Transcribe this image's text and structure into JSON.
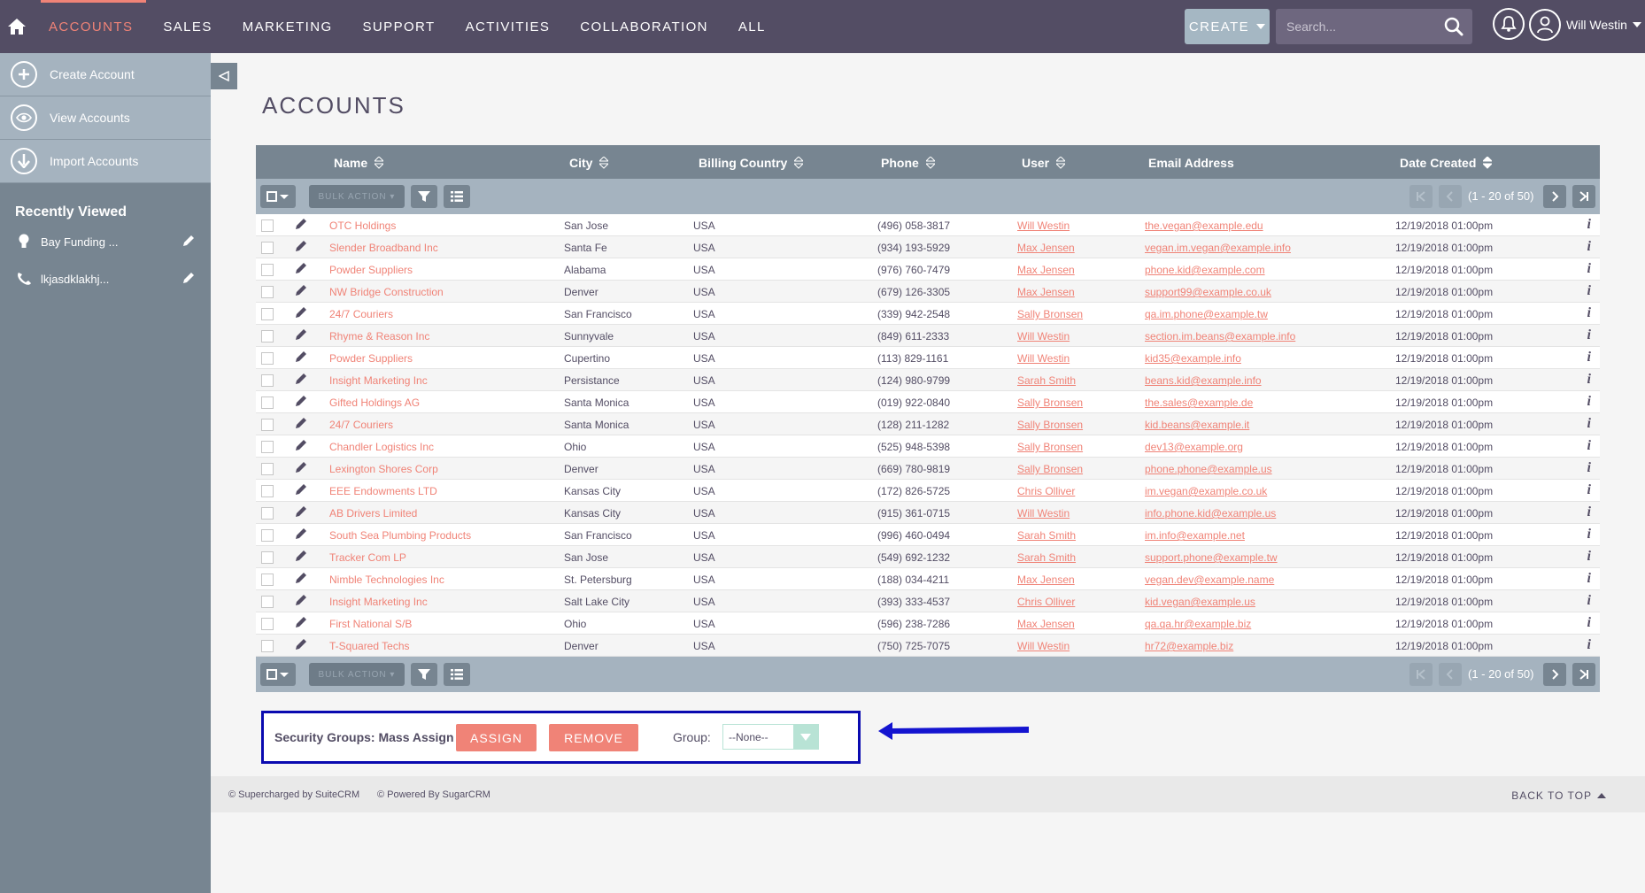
{
  "nav": {
    "items": [
      "ACCOUNTS",
      "SALES",
      "MARKETING",
      "SUPPORT",
      "ACTIVITIES",
      "COLLABORATION",
      "ALL"
    ],
    "create_label": "CREATE",
    "search_placeholder": "Search...",
    "user_name": "Will Westin"
  },
  "sidebar": {
    "actions": [
      "Create Account",
      "View Accounts",
      "Import Accounts"
    ],
    "recent_title": "Recently Viewed",
    "recent": [
      "Bay Funding ...",
      "lkjasdklakhj..."
    ]
  },
  "page_title": "ACCOUNTS",
  "table": {
    "columns": [
      "Name",
      "City",
      "Billing Country",
      "Phone",
      "User",
      "Email Address",
      "Date Created"
    ],
    "bulk_action_label": "BULK ACTION",
    "pagination": "(1 - 20 of 50)",
    "rows": [
      [
        "OTC Holdings",
        "San Jose",
        "USA",
        "(496) 058-3817",
        "Will Westin",
        "the.vegan@example.edu",
        "12/19/2018 01:00pm"
      ],
      [
        "Slender Broadband Inc",
        "Santa Fe",
        "USA",
        "(934) 193-5929",
        "Max Jensen",
        "vegan.im.vegan@example.info",
        "12/19/2018 01:00pm"
      ],
      [
        "Powder Suppliers",
        "Alabama",
        "USA",
        "(976) 760-7479",
        "Max Jensen",
        "phone.kid@example.com",
        "12/19/2018 01:00pm"
      ],
      [
        "NW Bridge Construction",
        "Denver",
        "USA",
        "(679) 126-3305",
        "Max Jensen",
        "support99@example.co.uk",
        "12/19/2018 01:00pm"
      ],
      [
        "24/7 Couriers",
        "San Francisco",
        "USA",
        "(339) 942-2548",
        "Sally Bronsen",
        "qa.im.phone@example.tw",
        "12/19/2018 01:00pm"
      ],
      [
        "Rhyme & Reason Inc",
        "Sunnyvale",
        "USA",
        "(849) 611-2333",
        "Will Westin",
        "section.im.beans@example.info",
        "12/19/2018 01:00pm"
      ],
      [
        "Powder Suppliers",
        "Cupertino",
        "USA",
        "(113) 829-1161",
        "Will Westin",
        "kid35@example.info",
        "12/19/2018 01:00pm"
      ],
      [
        "Insight Marketing Inc",
        "Persistance",
        "USA",
        "(124) 980-9799",
        "Sarah Smith",
        "beans.kid@example.info",
        "12/19/2018 01:00pm"
      ],
      [
        "Gifted Holdings AG",
        "Santa Monica",
        "USA",
        "(019) 922-0840",
        "Sally Bronsen",
        "the.sales@example.de",
        "12/19/2018 01:00pm"
      ],
      [
        "24/7 Couriers",
        "Santa Monica",
        "USA",
        "(128) 211-1282",
        "Sally Bronsen",
        "kid.beans@example.it",
        "12/19/2018 01:00pm"
      ],
      [
        "Chandler Logistics Inc",
        "Ohio",
        "USA",
        "(525) 948-5398",
        "Sally Bronsen",
        "dev13@example.org",
        "12/19/2018 01:00pm"
      ],
      [
        "Lexington Shores Corp",
        "Denver",
        "USA",
        "(669) 780-9819",
        "Sally Bronsen",
        "phone.phone@example.us",
        "12/19/2018 01:00pm"
      ],
      [
        "EEE Endowments LTD",
        "Kansas City",
        "USA",
        "(172) 826-5725",
        "Chris Olliver",
        "im.vegan@example.co.uk",
        "12/19/2018 01:00pm"
      ],
      [
        "AB Drivers Limited",
        "Kansas City",
        "USA",
        "(915) 361-0715",
        "Will Westin",
        "info.phone.kid@example.us",
        "12/19/2018 01:00pm"
      ],
      [
        "South Sea Plumbing Products",
        "San Francisco",
        "USA",
        "(996) 460-0494",
        "Sarah Smith",
        "im.info@example.net",
        "12/19/2018 01:00pm"
      ],
      [
        "Tracker Com LP",
        "San Jose",
        "USA",
        "(549) 692-1232",
        "Sarah Smith",
        "support.phone@example.tw",
        "12/19/2018 01:00pm"
      ],
      [
        "Nimble Technologies Inc",
        "St. Petersburg",
        "USA",
        "(188) 034-4211",
        "Max Jensen",
        "vegan.dev@example.name",
        "12/19/2018 01:00pm"
      ],
      [
        "Insight Marketing Inc",
        "Salt Lake City",
        "USA",
        "(393) 333-4537",
        "Chris Olliver",
        "kid.vegan@example.us",
        "12/19/2018 01:00pm"
      ],
      [
        "First National S/B",
        "Ohio",
        "USA",
        "(596) 238-7286",
        "Max Jensen",
        "qa.qa.hr@example.biz",
        "12/19/2018 01:00pm"
      ],
      [
        "T-Squared Techs",
        "Denver",
        "USA",
        "(750) 725-7075",
        "Will Westin",
        "hr72@example.biz",
        "12/19/2018 01:00pm"
      ]
    ]
  },
  "security_groups": {
    "label": "Security Groups: Mass Assign",
    "assign_label": "ASSIGN",
    "remove_label": "REMOVE",
    "group_label": "Group:",
    "group_value": "--None--"
  },
  "footer": {
    "supercharged": "© Supercharged by SuiteCRM",
    "powered": "© Powered By SugarCRM",
    "back_to_top": "BACK TO TOP"
  },
  "colors": {
    "nav_bg": "#534d64",
    "accent": "#f08377",
    "sidebar_bg": "#778591",
    "highlight_border": "#0a0ab0"
  }
}
